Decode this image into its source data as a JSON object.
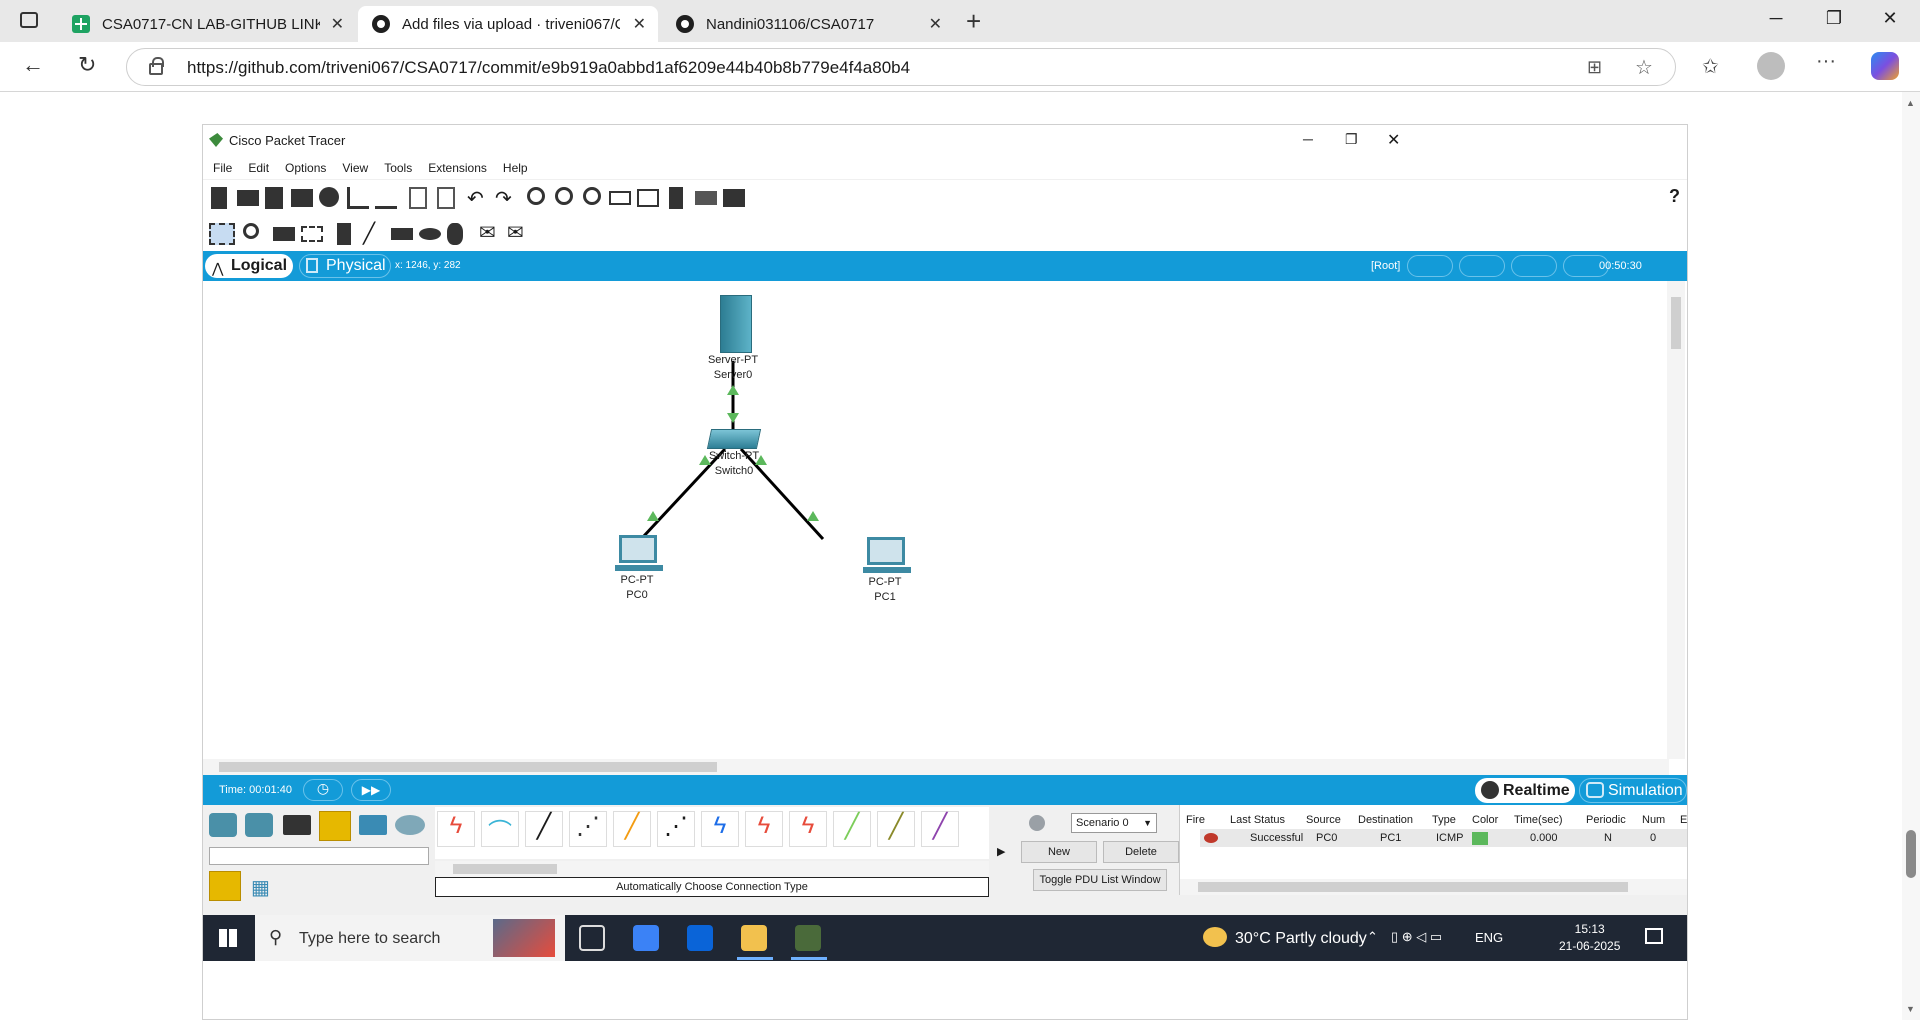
{
  "browser": {
    "tabs": [
      {
        "title": "CSA0717-CN LAB-GITHUB LINK -",
        "active": false
      },
      {
        "title": "Add files via upload · triveni067/C",
        "active": true
      },
      {
        "title": "Nandini031106/CSA0717",
        "active": false
      }
    ],
    "new_tab_symbol": "+",
    "url": "https://github.com/triveni067/CSA0717/commit/e9b919a0abbd1af6209e44b40b8b779e4f4a80b4"
  },
  "packet_tracer": {
    "title": "Cisco Packet Tracer",
    "menu": [
      "File",
      "Edit",
      "Options",
      "View",
      "Tools",
      "Extensions",
      "Help"
    ],
    "help_symbol": "?",
    "views": {
      "logical": "Logical",
      "physical": "Physical"
    },
    "cursor_coords": "x: 1246, y: 282",
    "root_label": "[Root]",
    "clock": "00:50:30",
    "devices": [
      {
        "model": "Server-PT",
        "name": "Server0"
      },
      {
        "model": "Switch-PT",
        "name": "Switch0"
      },
      {
        "model": "PC-PT",
        "name": "PC0"
      },
      {
        "model": "PC-PT",
        "name": "PC1"
      }
    ],
    "sim_time": "Time: 00:01:40",
    "modes": {
      "realtime": "Realtime",
      "simulation": "Simulation"
    },
    "connection_hint": "Automatically Choose Connection Type",
    "scenario": "Scenario 0",
    "buttons": {
      "new": "New",
      "delete": "Delete",
      "toggle": "Toggle PDU List Window"
    },
    "pdu_headers": [
      "Fire",
      "Last Status",
      "Source",
      "Destination",
      "Type",
      "Color",
      "Time(sec)",
      "Periodic",
      "Num",
      "E"
    ],
    "pdu_row": {
      "status": "Successful",
      "source": "PC0",
      "destination": "PC1",
      "type": "ICMP",
      "time": "0.000",
      "periodic": "N",
      "num": "0"
    }
  },
  "taskbar": {
    "search_placeholder": "Type here to search",
    "weather": "30°C  Partly cloudy",
    "language": "ENG",
    "time": "15:13",
    "date": "21-06-2025"
  },
  "colors": {
    "pt_blue": "#139bd8",
    "link_green": "#5cb85c",
    "taskbar": "#1f2734"
  }
}
